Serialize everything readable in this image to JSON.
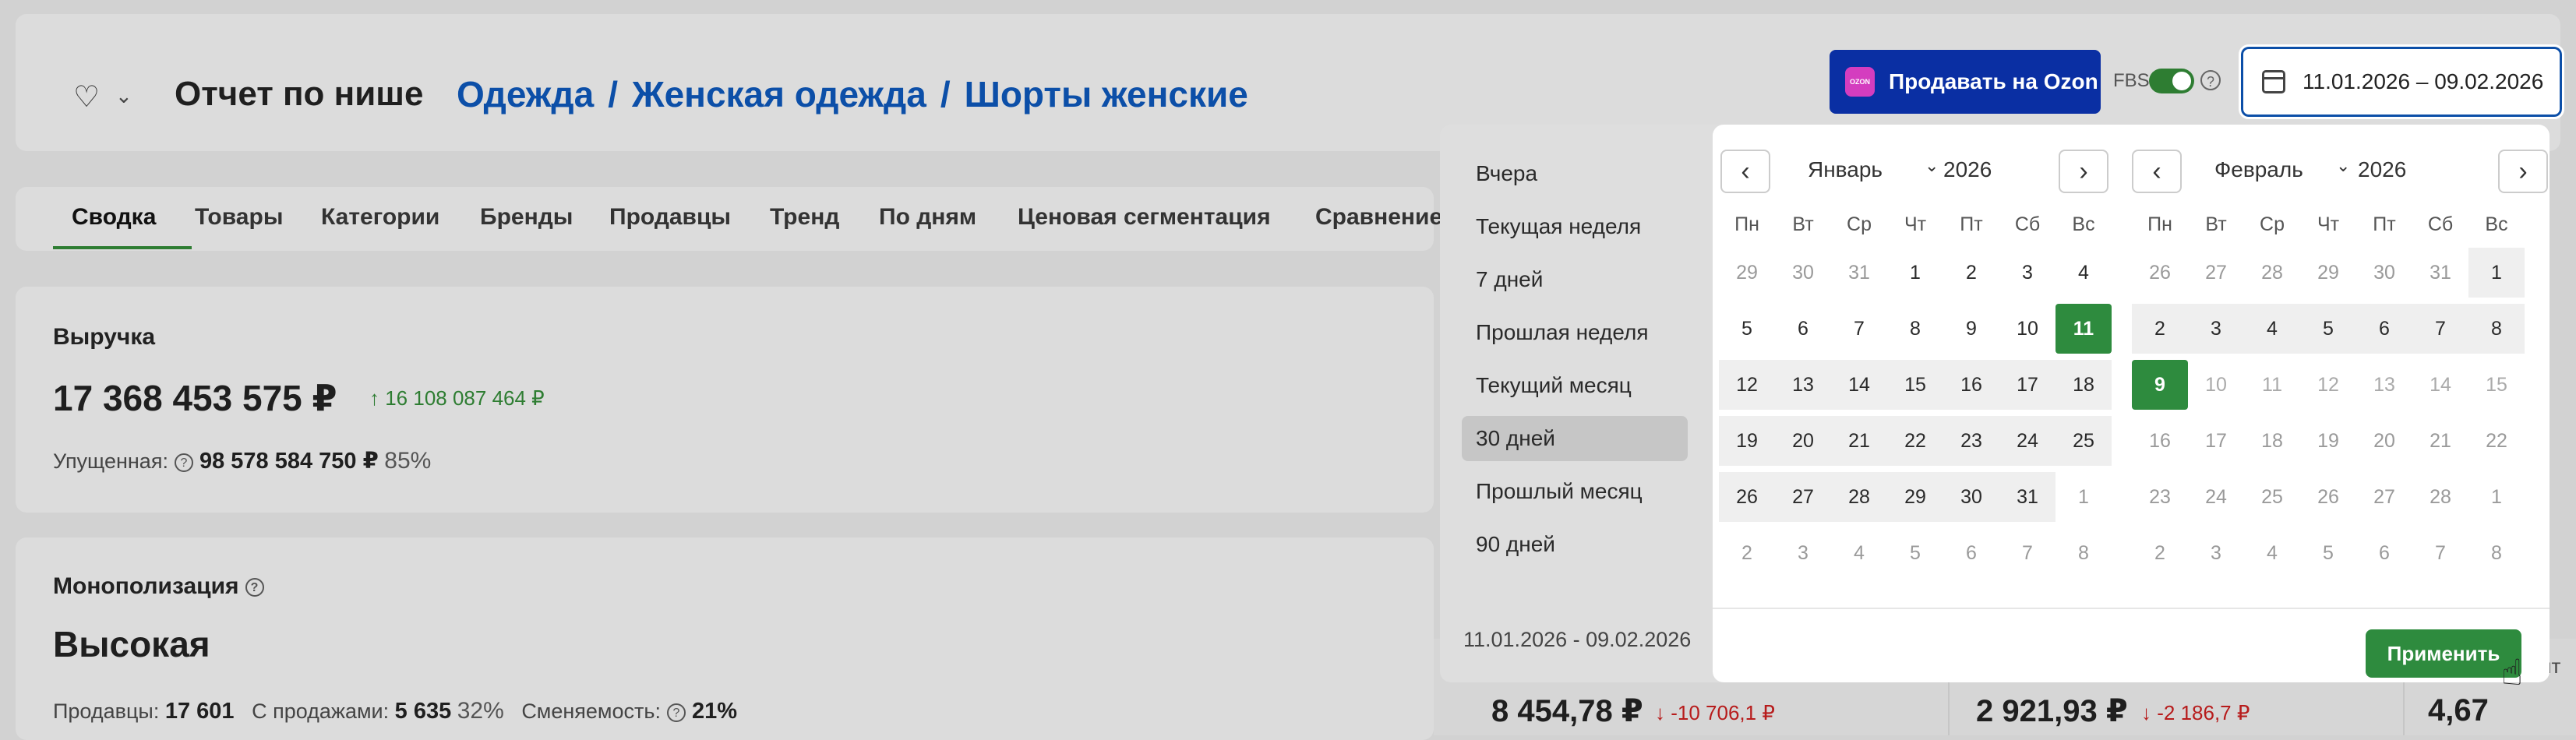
{
  "header": {
    "title": "Отчет по нише",
    "breadcrumbs": [
      "Одежда",
      "Женская одежда",
      "Шорты женские"
    ],
    "ozon_button": "Продавать на Ozon",
    "ozon_logo_text": "OZON",
    "fbs_label": "FBS",
    "fbs_enabled": true,
    "date_range": "11.01.2026 – 09.02.2026"
  },
  "tabs": [
    "Сводка",
    "Товары",
    "Категории",
    "Бренды",
    "Продавцы",
    "Тренд",
    "По дням",
    "Ценовая сегментация",
    "Сравнение"
  ],
  "active_tab": "Сводка",
  "revenue": {
    "label": "Выручка",
    "value": "17 368 453 575 ₽",
    "delta": "↑ 16 108 087 464 ₽",
    "missed_label": "Упущенная:",
    "missed_value": "98 578 584 750 ₽",
    "missed_pct": "85%"
  },
  "monopoly": {
    "label": "Монополизация",
    "value": "Высокая",
    "sellers_label": "Продавцы:",
    "sellers_value": "17 601",
    "with_sales_label": "С продажами:",
    "with_sales_value": "5 635",
    "with_sales_pct": "32%",
    "turnover_label": "Сменяемость:",
    "turnover_value": "21%"
  },
  "bottom_cards": [
    {
      "value": "8 454,78 ₽",
      "delta": "↓ -10 706,1 ₽"
    },
    {
      "value": "2 921,93 ₽",
      "delta": "↓ -2 186,7 ₽"
    },
    {
      "value": "4,67",
      "delta": ""
    }
  ],
  "bottom_partial_label": "йт",
  "picker": {
    "presets": [
      "Вчера",
      "Текущая неделя",
      "7 дней",
      "Прошлая неделя",
      "Текущий месяц",
      "30 дней",
      "Прошлый месяц",
      "90 дней"
    ],
    "selected_preset": "30 дней",
    "range_text": "11.01.2026 - 09.02.2026",
    "apply_label": "Применить",
    "weekdays": [
      "Пн",
      "Вт",
      "Ср",
      "Чт",
      "Пт",
      "Сб",
      "Вс"
    ],
    "months": [
      {
        "name": "Январь",
        "year": "2026",
        "days": [
          [
            "29",
            "30",
            "31",
            "1",
            "2",
            "3",
            "4"
          ],
          [
            "5",
            "6",
            "7",
            "8",
            "9",
            "10",
            "11"
          ],
          [
            "12",
            "13",
            "14",
            "15",
            "16",
            "17",
            "18"
          ],
          [
            "19",
            "20",
            "21",
            "22",
            "23",
            "24",
            "25"
          ],
          [
            "26",
            "27",
            "28",
            "29",
            "30",
            "31",
            "1"
          ],
          [
            "2",
            "3",
            "4",
            "5",
            "6",
            "7",
            "8"
          ]
        ]
      },
      {
        "name": "Февраль",
        "year": "2026",
        "days": [
          [
            "26",
            "27",
            "28",
            "29",
            "30",
            "31",
            "1"
          ],
          [
            "2",
            "3",
            "4",
            "5",
            "6",
            "7",
            "8"
          ],
          [
            "9",
            "10",
            "11",
            "12",
            "13",
            "14",
            "15"
          ],
          [
            "16",
            "17",
            "18",
            "19",
            "20",
            "21",
            "22"
          ],
          [
            "23",
            "24",
            "25",
            "26",
            "27",
            "28",
            "1"
          ],
          [
            "2",
            "3",
            "4",
            "5",
            "6",
            "7",
            "8"
          ]
        ]
      }
    ]
  }
}
